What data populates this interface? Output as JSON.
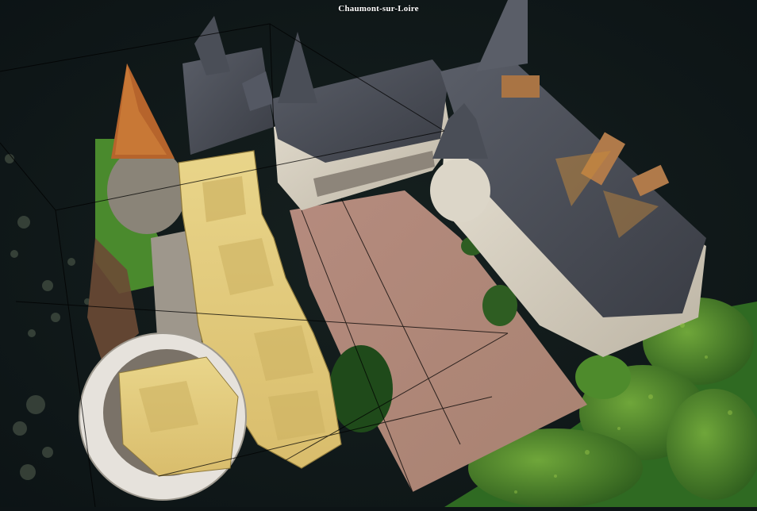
{
  "viewer": {
    "title": "Chaumont-sur-Loire"
  },
  "colors": {
    "background": "#0d1416",
    "section_fill": "#e8cf7e",
    "roof": "#4b4f58",
    "wall": "#d9d3c6",
    "courtyard": "#b6897c",
    "vegetation": "#3e7a2a",
    "tower_roof_highlight": "#c86a2c"
  },
  "icons": {
    "bounding_box": "wireframe-box-icon"
  }
}
